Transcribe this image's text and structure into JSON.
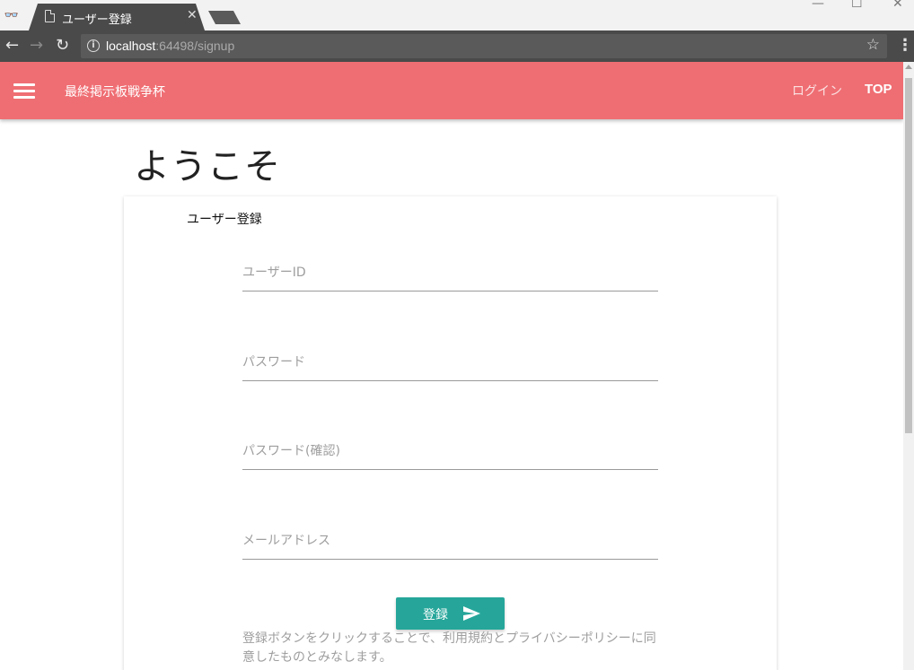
{
  "browser": {
    "tab_title": "ユーザー登録",
    "url_host": "localhost",
    "url_rest": ":64498/signup"
  },
  "appbar": {
    "brand": "最終掲示板戦争杯",
    "nav_login": "ログイン",
    "nav_top": "TOP",
    "color": "#ef6e73"
  },
  "page": {
    "heading": "ようこそ"
  },
  "form": {
    "title": "ユーザー登録",
    "user_id_placeholder": "ユーザーID",
    "password_placeholder": "パスワード",
    "password_confirm_placeholder": "パスワード(確認)",
    "email_placeholder": "メールアドレス",
    "submit_label": "登録",
    "submit_color": "#26a69a",
    "terms_text": "登録ボタンをクリックすることで、利用規約とプライバシーポリシーに同意したものとみなします。"
  },
  "icons": [
    "incognito-icon",
    "page-icon",
    "close-icon",
    "back-icon",
    "forward-icon",
    "reload-icon",
    "info-icon",
    "star-icon",
    "menu-icon",
    "hamburger-icon",
    "send-icon"
  ]
}
